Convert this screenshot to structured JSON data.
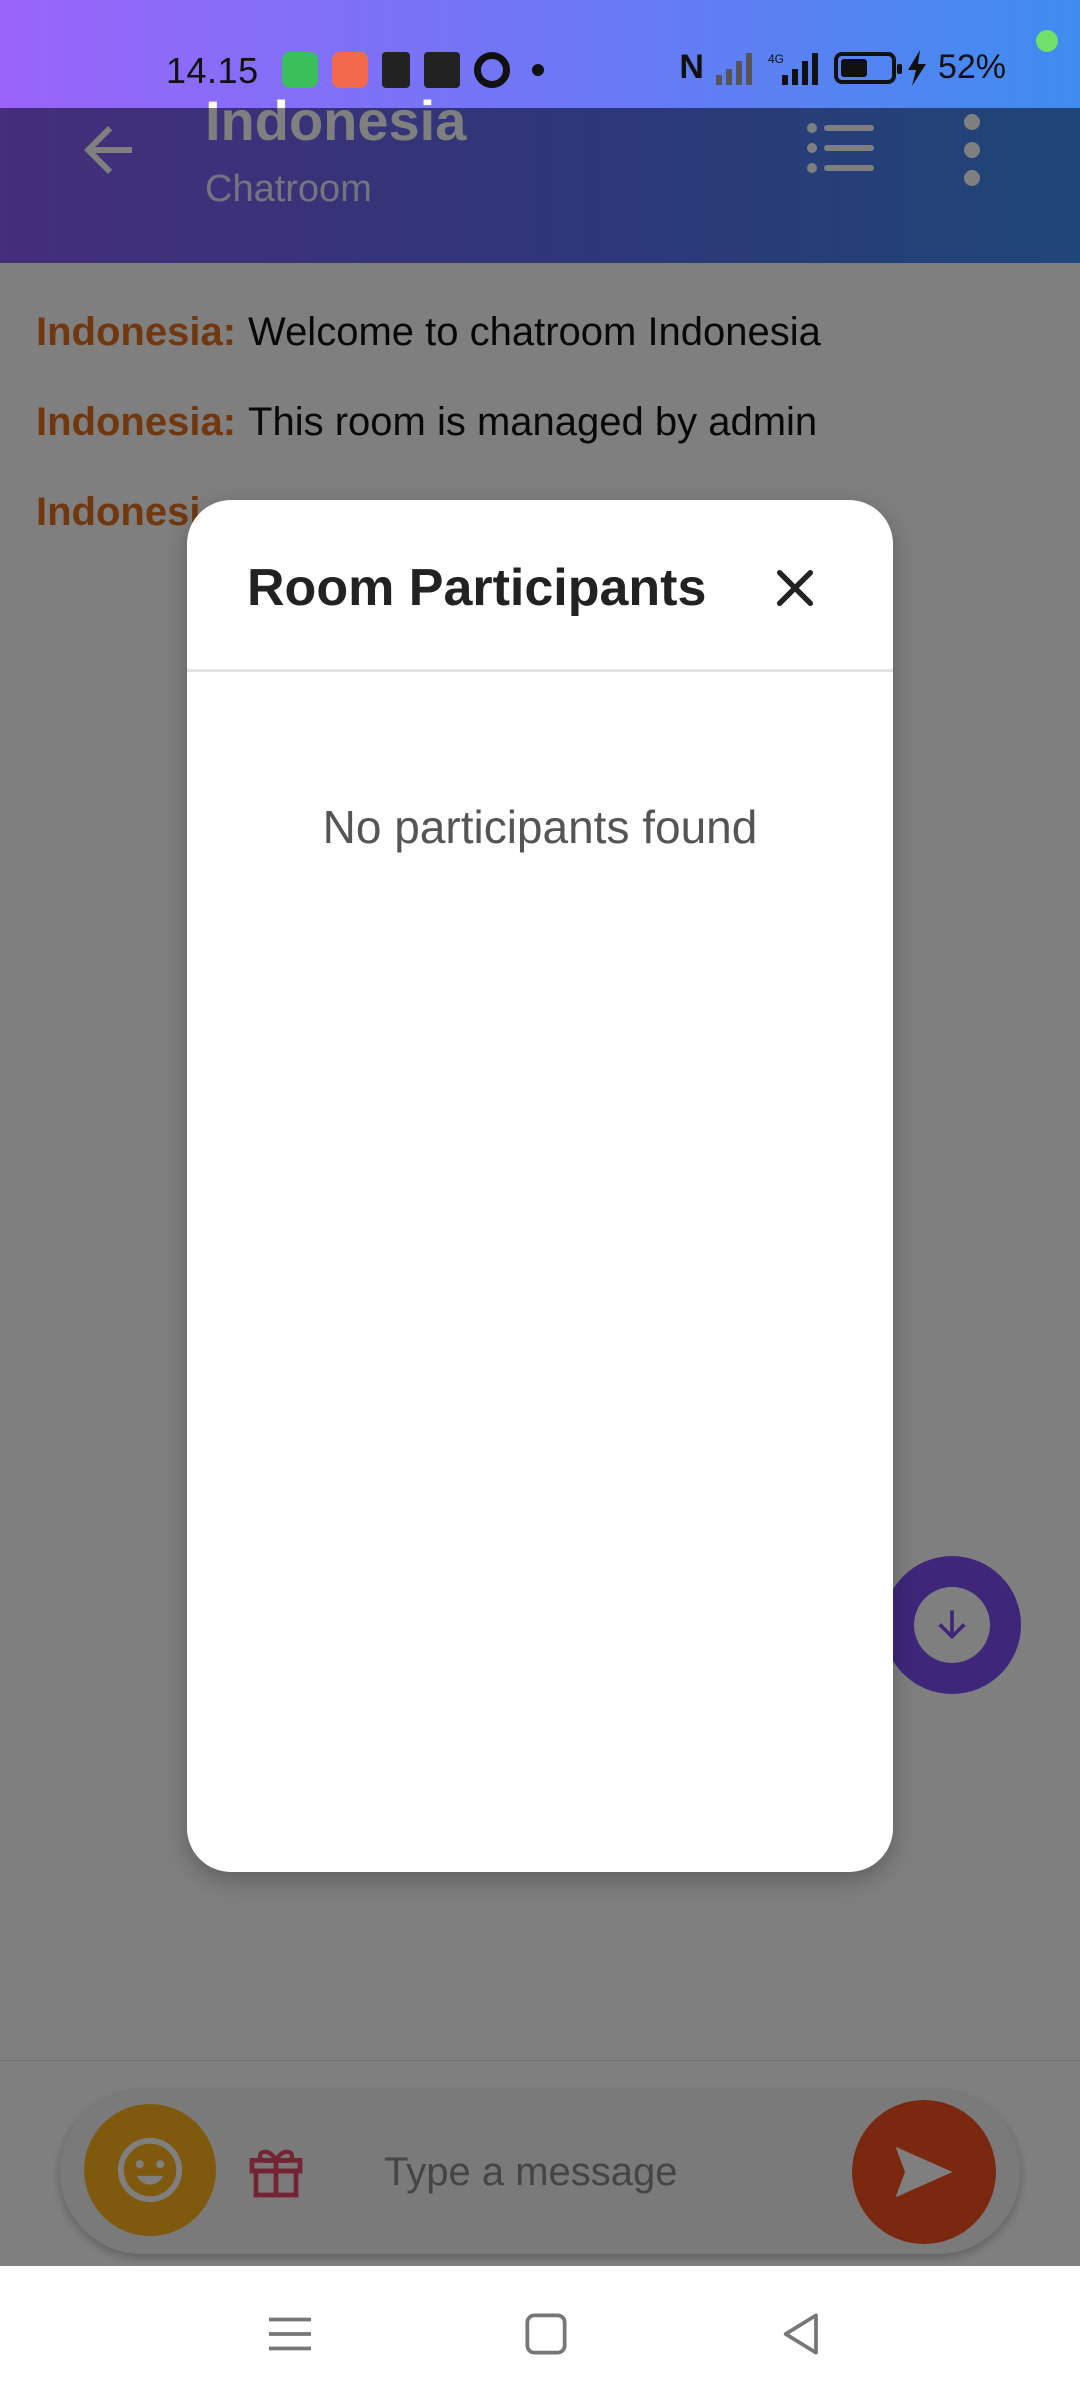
{
  "status_bar": {
    "time": "14.15",
    "battery_percent": "52%",
    "network": "4G",
    "icons": [
      "shopping-app-icon",
      "game-app-icon",
      "music-app-icon",
      "tv-app-icon",
      "circle-app-icon",
      "dot-icon",
      "nfc-icon",
      "signal-icon",
      "battery-icon",
      "charging-icon"
    ]
  },
  "app_bar": {
    "title": "Indonesia",
    "subtitle": "Chatroom",
    "gradient_colors": [
      "#8a5cf6",
      "#3f8cf0"
    ]
  },
  "messages": [
    {
      "sender": "Indonesia:",
      "text": "Welcome to chatroom Indonesia"
    },
    {
      "sender": "Indonesia:",
      "text": "This room is managed by admin"
    },
    {
      "sender": "Indonesi",
      "text": ""
    }
  ],
  "composer": {
    "placeholder": "Type a message",
    "emoji_color": "#ffb21a",
    "send_color": "#f4511e"
  },
  "scroll_down_fab_color": "#7d4ff4",
  "modal": {
    "title": "Room Participants",
    "empty_message": "No participants found"
  },
  "colors": {
    "sender": "#e27020",
    "scrim": "rgba(0,0,0,0.5)"
  }
}
